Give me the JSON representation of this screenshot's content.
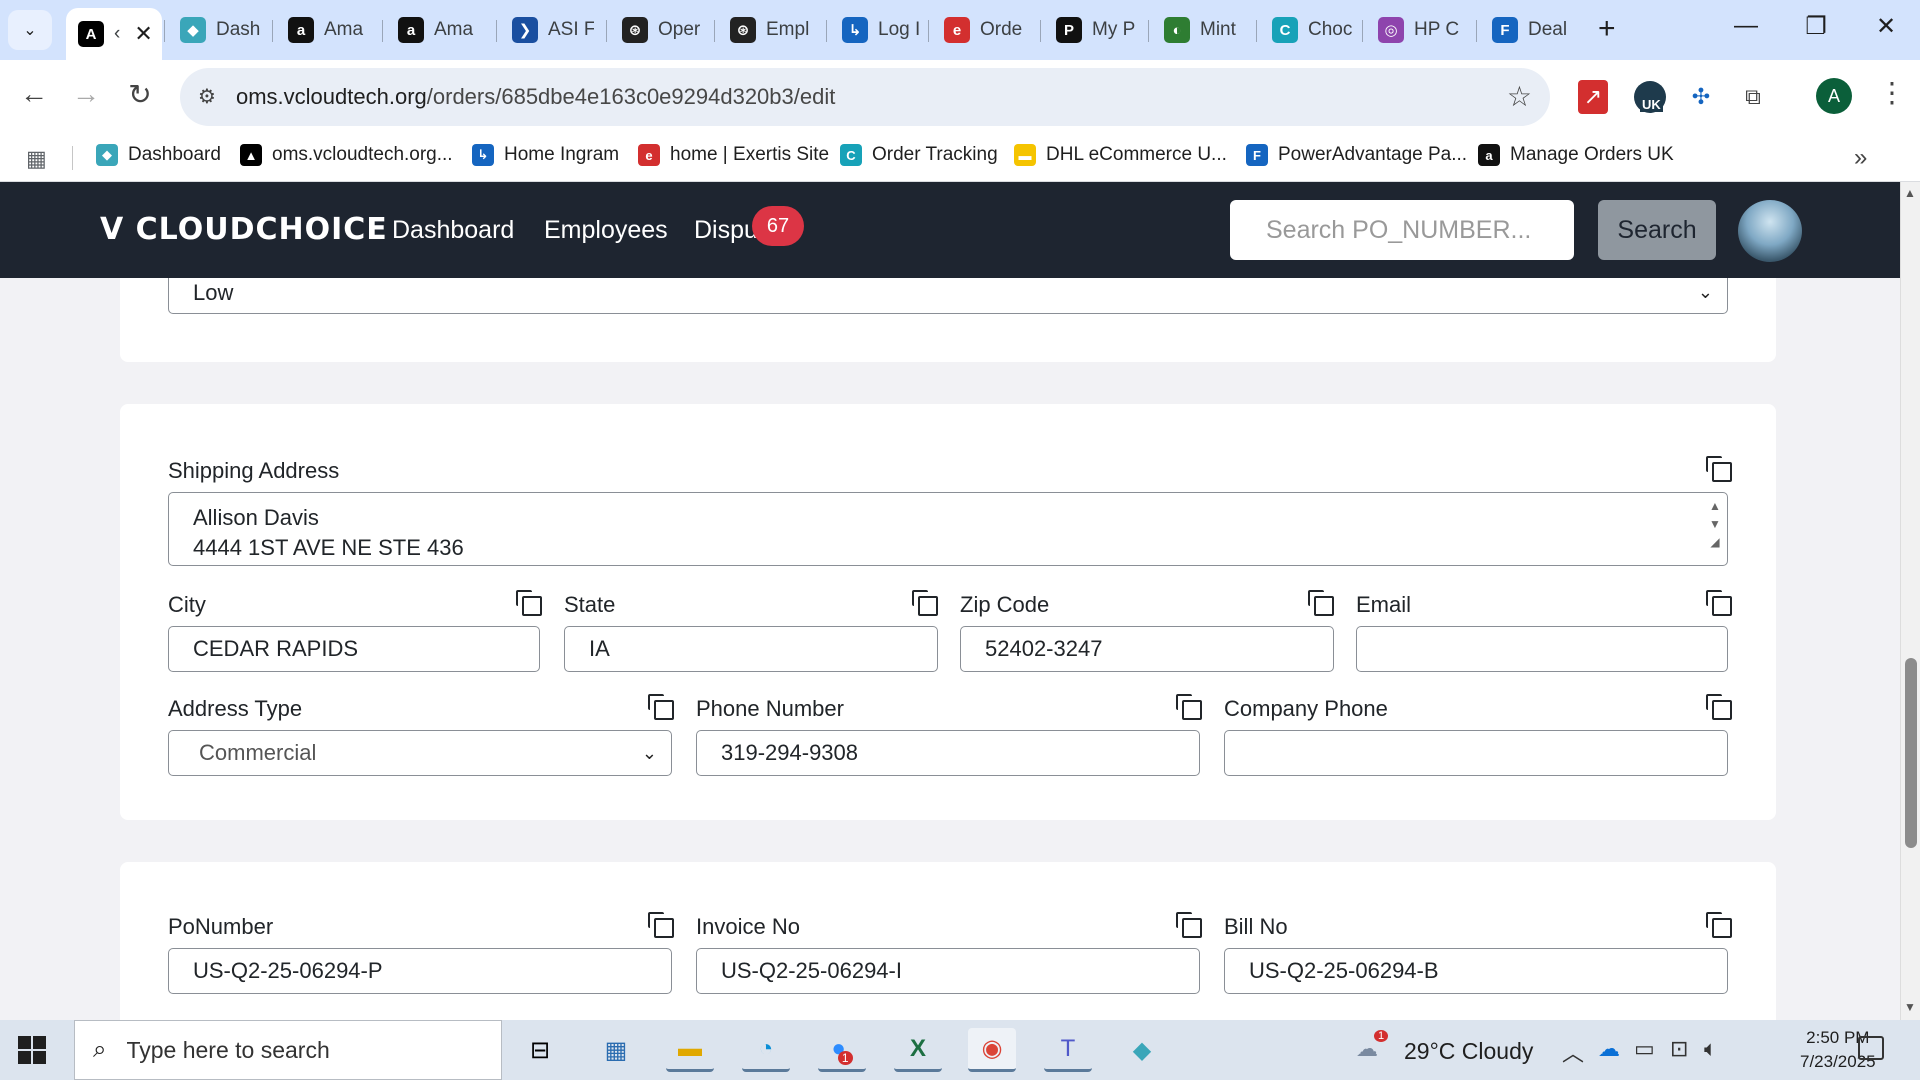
{
  "browser": {
    "tabs": [
      {
        "label": "‹",
        "fav": "A",
        "color": "#000000",
        "active": true
      },
      {
        "label": "Dash",
        "fav": "◆",
        "color": "#3aa6b9"
      },
      {
        "label": "Ama",
        "fav": "a",
        "color": "#111111"
      },
      {
        "label": "Ama",
        "fav": "a",
        "color": "#111111"
      },
      {
        "label": "ASI F",
        "fav": "❯",
        "color": "#1a4fa0"
      },
      {
        "label": "Oper",
        "fav": "⊛",
        "color": "#222222"
      },
      {
        "label": "Empl",
        "fav": "⊛",
        "color": "#222222"
      },
      {
        "label": "Log I",
        "fav": "↳",
        "color": "#1565c0"
      },
      {
        "label": "Orde",
        "fav": "e",
        "color": "#d32f2f"
      },
      {
        "label": "My P",
        "fav": "P",
        "color": "#111111"
      },
      {
        "label": "Mint",
        "fav": "◐",
        "color": "#2e7d32"
      },
      {
        "label": "Choc",
        "fav": "C",
        "color": "#17a2b8"
      },
      {
        "label": "HP C",
        "fav": "◎",
        "color": "#8e44ad"
      },
      {
        "label": "Deal",
        "fav": "F",
        "color": "#1565c0"
      }
    ],
    "url_host": "oms.vcloudtech.org",
    "url_path": "/orders/685dbe4e163c0e9294d320b3/edit",
    "profile_initial": "A",
    "ext_badge": "UK",
    "bookmarks": [
      {
        "label": "Dashboard",
        "fav": "◆",
        "color": "#3aa6b9"
      },
      {
        "label": "oms.vcloudtech.org...",
        "fav": "▲",
        "color": "#000000"
      },
      {
        "label": "Home Ingram",
        "fav": "↳",
        "color": "#1565c0"
      },
      {
        "label": "home | Exertis Site",
        "fav": "e",
        "color": "#d32f2f"
      },
      {
        "label": "Order Tracking",
        "fav": "C",
        "color": "#17a2b8"
      },
      {
        "label": "DHL eCommerce U...",
        "fav": "▬",
        "color": "#f5c400"
      },
      {
        "label": "PowerAdvantage Pa...",
        "fav": "F",
        "color": "#1565c0"
      },
      {
        "label": "Manage Orders UK",
        "fav": "a",
        "color": "#111111"
      }
    ]
  },
  "app": {
    "logo": "V CLOUDCHOICE",
    "nav": {
      "dashboard": "Dashboard",
      "employees": "Employees",
      "disputes": "Dispu",
      "disputes_count": "67"
    },
    "search_placeholder": "Search PO_NUMBER...",
    "search_button": "Search"
  },
  "form": {
    "priority_value": "Low",
    "shipping": {
      "label": "Shipping Address",
      "line1": "Allison Davis",
      "line2": "4444 1ST AVE NE STE 436"
    },
    "city": {
      "label": "City",
      "value": "CEDAR RAPIDS"
    },
    "state": {
      "label": "State",
      "value": "IA"
    },
    "zip": {
      "label": "Zip Code",
      "value": "52402-3247"
    },
    "email": {
      "label": "Email",
      "value": ""
    },
    "address_type": {
      "label": "Address Type",
      "value": "Commercial"
    },
    "phone": {
      "label": "Phone Number",
      "value": "319-294-9308"
    },
    "company_phone": {
      "label": "Company Phone",
      "value": ""
    },
    "po_number": {
      "label": "PoNumber",
      "value": "US-Q2-25-06294-P"
    },
    "invoice_no": {
      "label": "Invoice No",
      "value": "US-Q2-25-06294-I"
    },
    "bill_no": {
      "label": "Bill No",
      "value": "US-Q2-25-06294-B"
    }
  },
  "taskbar": {
    "search_placeholder": "Type here to search",
    "weather": "29°C  Cloudy",
    "weather_badge": "1",
    "time": "2:50 PM",
    "date": "7/23/2025",
    "zoom_badge": "1"
  }
}
